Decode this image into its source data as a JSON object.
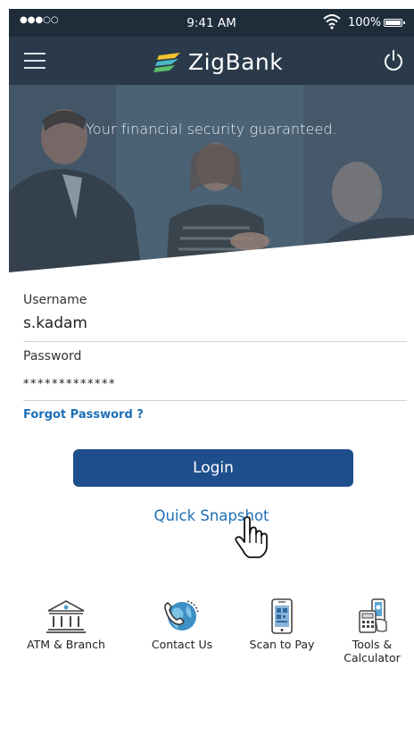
{
  "status_bar": {
    "signal": "●●●○○",
    "time": "9:41 AM",
    "battery": "100%"
  },
  "header": {
    "brand": "ZigBank",
    "menu_icon": "hamburger-menu-icon",
    "power_icon": "power-icon"
  },
  "hero": {
    "tagline": "Your financial security guaranteed."
  },
  "login_form": {
    "username_label": "Username",
    "username_value": "s.kadam",
    "password_label": "Password",
    "password_value": "*************",
    "forgot_password": "Forgot Password ?",
    "login_button": "Login",
    "quick_snapshot": "Quick Snapshot"
  },
  "shortcuts": [
    {
      "label": "ATM & Branch",
      "icon": "bank-building-icon"
    },
    {
      "label": "Contact Us",
      "icon": "globe-phone-icon"
    },
    {
      "label": "Scan to Pay",
      "icon": "qr-phone-icon"
    },
    {
      "label": "Tools &\nCalculator",
      "icon": "calculator-icon"
    }
  ],
  "colors": {
    "header_bg": "#2a3a4a",
    "status_bg": "#1f2d3b",
    "primary_button": "#1e4e8c",
    "link": "#1d6fb8"
  }
}
